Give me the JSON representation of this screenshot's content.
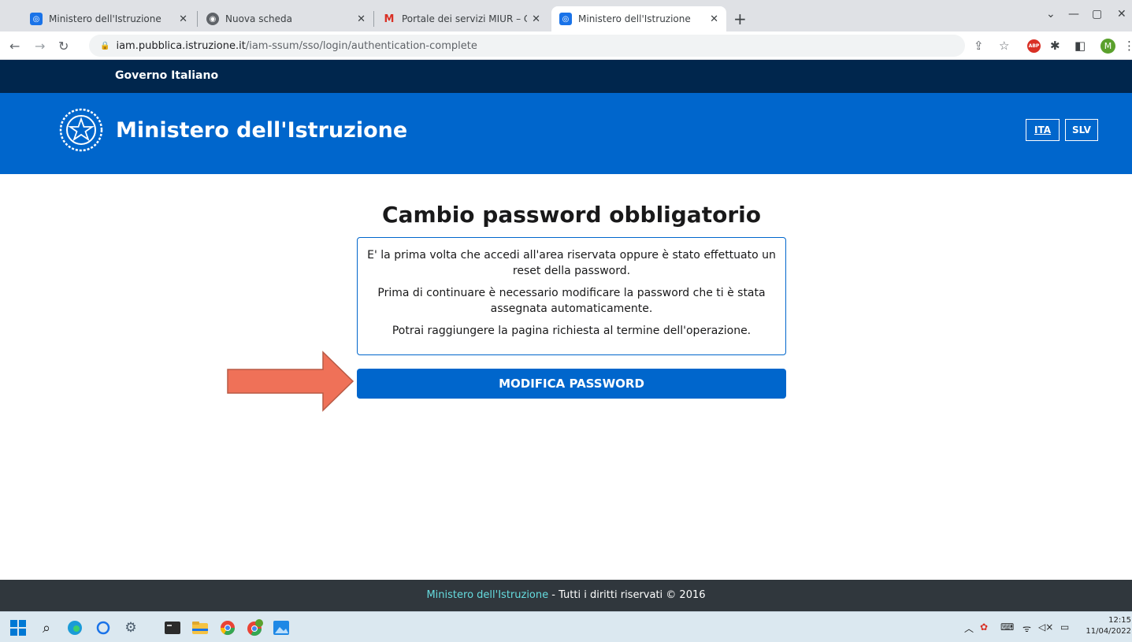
{
  "browser": {
    "tabs": [
      {
        "title": "Ministero dell'Istruzione",
        "favicon": "ministry-favicon",
        "active": false
      },
      {
        "title": "Nuova scheda",
        "favicon": "chrome-favicon",
        "active": false
      },
      {
        "title": "Portale dei servizi MIUR – Creazio",
        "favicon": "gmail-favicon",
        "active": false
      },
      {
        "title": "Ministero dell'Istruzione",
        "favicon": "ministry-favicon",
        "active": true
      }
    ],
    "address": {
      "domain": "iam.pubblica.istruzione.it",
      "path": "/iam-ssum/sso/login/authentication-complete"
    },
    "profile_initial": "M",
    "abp_label": "ABP"
  },
  "page": {
    "gov_label": "Governo Italiano",
    "site_title": "Ministero dell'Istruzione",
    "languages": [
      {
        "label": "ITA",
        "active": true
      },
      {
        "label": "SLV",
        "active": false
      }
    ],
    "main_title": "Cambio password obbligatorio",
    "info_paragraphs": [
      "E' la prima volta che accedi all'area riservata oppure è stato effettuato un reset della password.",
      "Prima di continuare è necessario modificare la password che ti è stata assegnata automaticamente.",
      "Potrai raggiungere la pagina richiesta al termine dell'operazione."
    ],
    "button_label": "MODIFICA PASSWORD",
    "footer_link": "Ministero dell'Istruzione",
    "footer_text": " - Tutti i diritti riservati © 2016"
  },
  "taskbar": {
    "time": "12:15",
    "date": "11/04/2022"
  },
  "colors": {
    "brand_blue": "#0066cc",
    "gov_bar": "#00264d",
    "footer": "#30373d",
    "arrow": "#ef7158"
  }
}
